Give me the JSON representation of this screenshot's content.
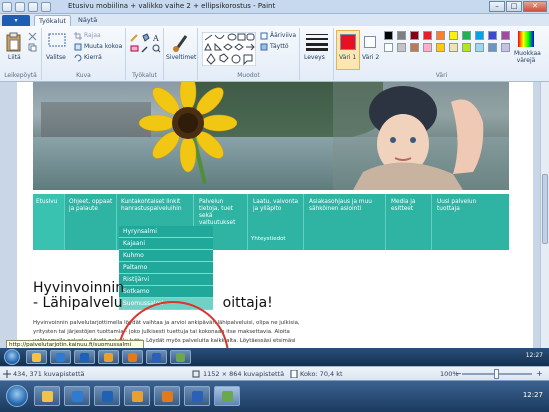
{
  "window": {
    "title": "Etusivu mobiilina + valikko vaihe 2 + ellipsikorostus - Paint",
    "minimize": "–",
    "maximize": "□",
    "close": "✕"
  },
  "ribbon": {
    "tabs": [
      "Työkalut",
      "Näytä"
    ],
    "groups": {
      "clipboard": {
        "label": "Leikepöytä",
        "paste": "Liitä"
      },
      "image": {
        "label": "Kuva",
        "select": "Valitse",
        "crop": "Rajaa",
        "resize": "Muuta kokoa",
        "rotate": "Kierrä"
      },
      "tools": {
        "label": "Työkalut"
      },
      "brushes": {
        "label": "Siveltimet"
      },
      "shapes": {
        "label": "Muodot",
        "outline": "Ääriviiva",
        "fill": "Täyttö"
      },
      "size": {
        "label": "Leveys"
      },
      "colors": {
        "label": "Väri",
        "color1": "Väri 1",
        "color2": "Väri 2",
        "edit": "Muokkaa värejä",
        "color1_value": "#e81123",
        "color2_value": "#ffffff",
        "palette": [
          "#000000",
          "#7f7f7f",
          "#880015",
          "#ed1c24",
          "#ff7f27",
          "#fff200",
          "#22b14c",
          "#00a2e8",
          "#3f48cc",
          "#a349a4",
          "#ffffff",
          "#c3c3c3",
          "#b97a57",
          "#ffaec9",
          "#ffc90e",
          "#efe4b0",
          "#b5e61d",
          "#99d9ea",
          "#7092be",
          "#c8bfe7"
        ]
      }
    }
  },
  "website": {
    "nav": [
      "Etusivu",
      "Ohjeet, oppaat ja palaute",
      "Kuntakohtaiset linkit hanrastuspalveluihin",
      "Palvelun tietoja, tuet sekä valtuutukset",
      "Laatu, valvonta ja ylläpito",
      "Asiakasohjaus ja muu sähköinen asiointi",
      "Media ja esitteet",
      "Uusi palvelun tuottaja"
    ],
    "dropdown": [
      "Hyrynsalmi",
      "Kajaani",
      "Kuhmo",
      "Paltamo",
      "Ristijärvi",
      "Sotkamo",
      "Suomussalmi"
    ],
    "sub_label": "Yhteystiedot",
    "heading_line1": "Hyvinvoinnin",
    "heading_line2": "- Lähipalvelu",
    "heading_tail": "oittaja!",
    "body_text": "Hyvinvoinnin palvelutarjottimella löydät vaihtaa ja arvioi ankipävän lähipalveluisi, olipa ne julkisia, yritysten tai järjestöjen tuottamia - joko julkisesti tuettuja tai kokonaan itse maksettavia. Aloita valitsemalla palvelu. Löydä palvelu tuttu. Löydät myös palveluita kaikkialta. Löytäessäsi etsimäsi palvelun tutki INFO-palvosta"
  },
  "tooltip": "http://palvelutarjotin.kainuu.fi/suomussalmi",
  "inner_taskbar": {
    "time": "12:27"
  },
  "statusbar": {
    "cursor": "434, 371 kuvapistettä",
    "image_size": "1152 × 864 kuvapistettä",
    "file_size": "Koko: 70,4 kt",
    "zoom": "100%",
    "zoom_level": 0.5
  },
  "taskbar": {
    "time": "12:27"
  }
}
